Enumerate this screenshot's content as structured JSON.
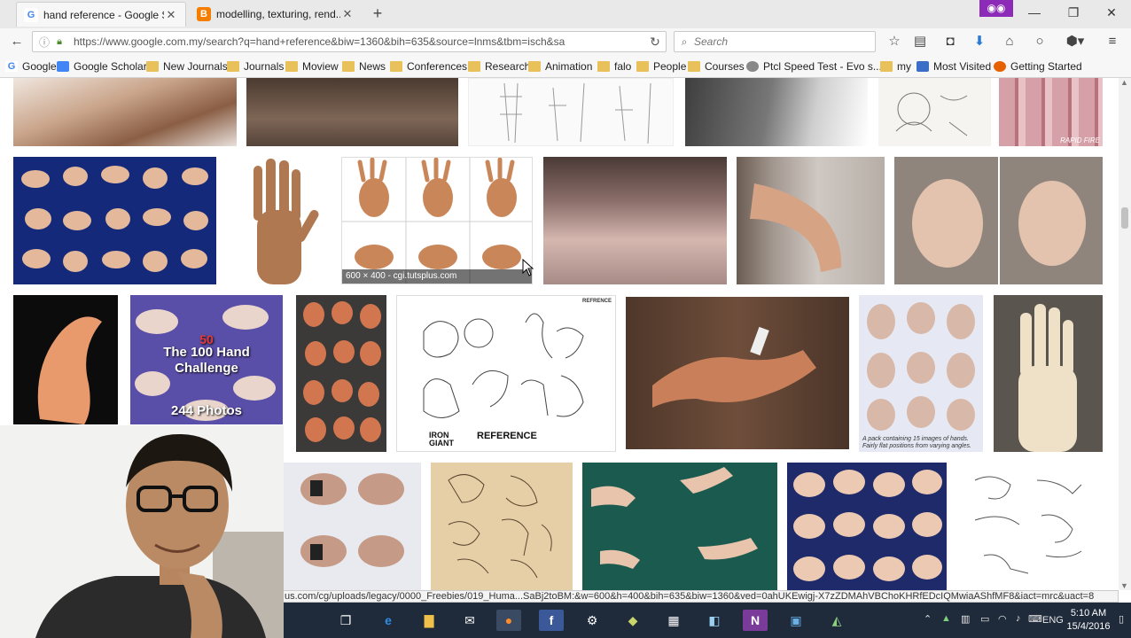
{
  "browser": {
    "tabs": [
      {
        "title": "hand reference - Google S...",
        "active": true
      },
      {
        "title": "modelling, texturing, rend...",
        "active": false
      }
    ],
    "privacy_icon": "mask-icon",
    "url": "https://www.google.com.my/search?q=hand+reference&biw=1360&bih=635&source=lnms&tbm=isch&sa",
    "search_placeholder": "Search"
  },
  "bookmarks": [
    {
      "label": "Google",
      "icon": "g"
    },
    {
      "label": "Google Scholar",
      "icon": "gs"
    },
    {
      "label": "New Journals",
      "icon": "folder"
    },
    {
      "label": "Journals",
      "icon": "folder"
    },
    {
      "label": "Moview",
      "icon": "folder"
    },
    {
      "label": "News",
      "icon": "folder"
    },
    {
      "label": "Conferences",
      "icon": "folder"
    },
    {
      "label": "Research",
      "icon": "folder"
    },
    {
      "label": "Animation",
      "icon": "folder"
    },
    {
      "label": "falo",
      "icon": "folder"
    },
    {
      "label": "People",
      "icon": "folder"
    },
    {
      "label": "Courses",
      "icon": "folder"
    },
    {
      "label": "Ptcl Speed Test - Evo s...",
      "icon": "ptcl"
    },
    {
      "label": "my",
      "icon": "folder"
    },
    {
      "label": "Most Visited",
      "icon": "mv"
    },
    {
      "label": "Getting Started",
      "icon": "ff"
    }
  ],
  "results": {
    "hover_caption": "600 × 400 - cgi.tutsplus.com",
    "challenge_top": "The 100 Hand",
    "challenge_mid": "Challenge",
    "challenge_bottom": "244 Photos",
    "challenge_num": "50",
    "iron_giant_logo": "IRON GIANT",
    "reference_label": "REFERENCE",
    "refrence_corner": "REFRENCE",
    "pack_caption": "A pack containing 15 images of hands. Fairly flat positions from varying angles.",
    "rapid_fire": "RAPID FIRE"
  },
  "status_link": "us.com/cg/uploads/legacy/0000_Freebies/019_Huma...SaBj2toBM:&w=600&h=400&bih=635&biw=1360&ved=0ahUKEwigj-X7zZDMAhVBChoKHRfEDcIQMwiaAShfMF8&iact=mrc&uact=8",
  "taskbar": {
    "language": "ENG",
    "time": "5:10 AM",
    "date": "15/4/2016"
  },
  "colors": {
    "tab_strip": "#e9e9e9",
    "taskbar": "#1f2a3a",
    "privacy": "#8c2bb8"
  }
}
